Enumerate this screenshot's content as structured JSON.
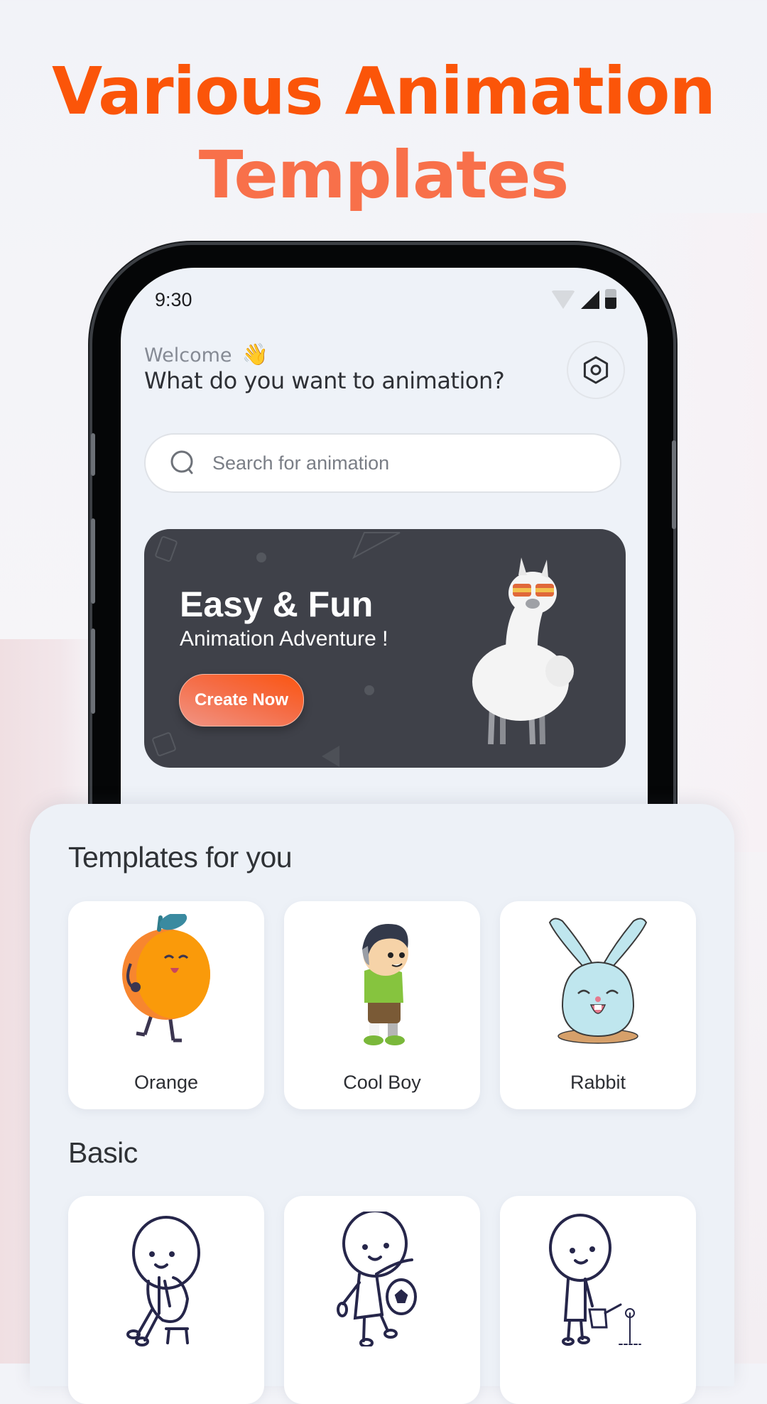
{
  "headline": {
    "line1": "Various Animation",
    "line2": "Templates"
  },
  "status_bar": {
    "time": "9:30",
    "icons": [
      "wifi-icon",
      "signal-icon",
      "battery-icon"
    ]
  },
  "header": {
    "welcome": "Welcome",
    "wave_emoji": "👋",
    "question": "What do you want to animation?",
    "settings_icon": "hexagon-settings-icon"
  },
  "search": {
    "placeholder": "Search for animation",
    "value": "",
    "icon": "search-icon"
  },
  "banner": {
    "title": "Easy & Fun",
    "subtitle": "Animation Adventure !",
    "button_label": "Create Now",
    "illustration": "llama-with-sunglasses"
  },
  "sections": [
    {
      "title": "Templates for you",
      "items": [
        {
          "label": "Orange",
          "art": "orange-character"
        },
        {
          "label": "Cool Boy",
          "art": "cool-boy-character"
        },
        {
          "label": "Rabbit",
          "art": "rabbit-character"
        }
      ]
    },
    {
      "title": "Basic",
      "items": [
        {
          "label": "",
          "art": "stick-figure-sitting"
        },
        {
          "label": "",
          "art": "stick-figure-football"
        },
        {
          "label": "",
          "art": "stick-figure-watering"
        }
      ]
    }
  ],
  "colors": {
    "accent": "#fb5509",
    "accent_light": "#f8704a",
    "banner_bg": "#3f4149",
    "sheet_bg": "#edf1f7"
  }
}
